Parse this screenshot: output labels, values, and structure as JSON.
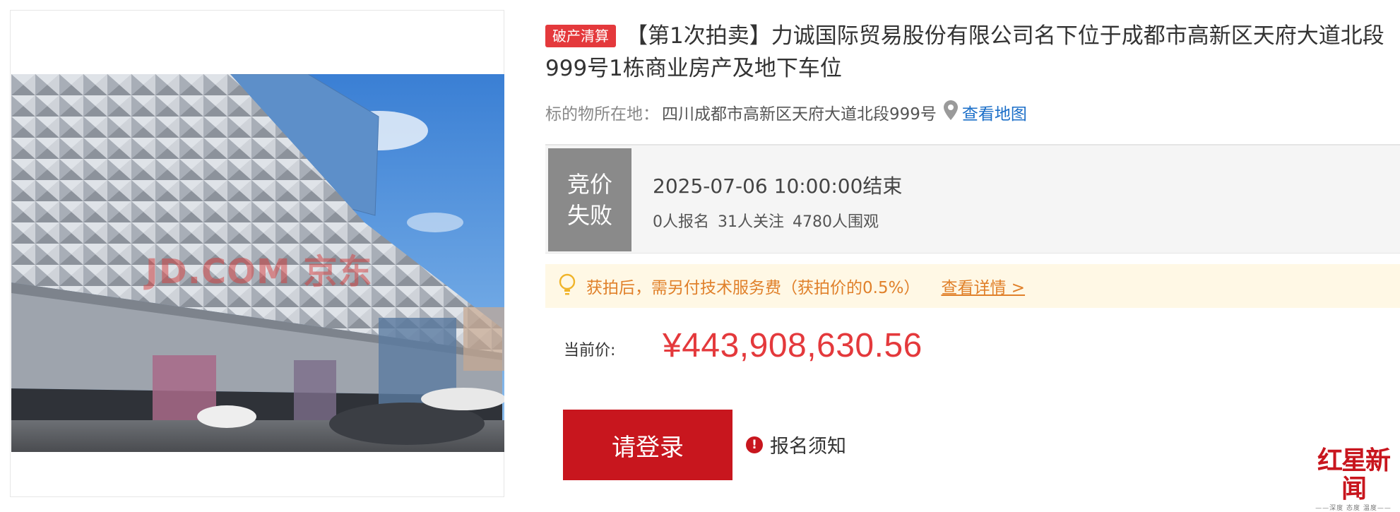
{
  "photo": {
    "alt": "Building exterior photo",
    "watermark": "JD.COM 京东"
  },
  "header": {
    "tag": "破产清算",
    "title": "【第1次拍卖】力诚国际贸易股份有限公司名下位于成都市高新区天府大道北段999号1栋商业房产及地下车位"
  },
  "location": {
    "label": "标的物所在地：",
    "address": "四川成都市高新区天府大道北段999号",
    "map_link": "查看地图",
    "icon": "location-pin-icon"
  },
  "status": {
    "badge_line1": "竞价",
    "badge_line2": "失败",
    "end_time": "2025-07-06 10:00:00结束",
    "registered": "0人报名",
    "followers": "31人关注",
    "viewers": "4780人围观"
  },
  "notice": {
    "icon": "lightbulb-icon",
    "text": "获拍后，需另付技术服务费（获拍价的0.5%）",
    "link": "查看详情 >"
  },
  "price": {
    "label": "当前价:",
    "value": "¥443,908,630.56"
  },
  "actions": {
    "login": "请登录",
    "registration_notice": "报名须知",
    "alert_icon_glyph": "!"
  },
  "logo": {
    "main": "红星新闻",
    "sub": "——深度 态度 温度——"
  },
  "colors": {
    "accent_red": "#e4393c",
    "button_red": "#c8161e",
    "link_blue": "#1a6ec8",
    "notice_orange": "#e0802a",
    "status_gray": "#8a8a8a"
  }
}
